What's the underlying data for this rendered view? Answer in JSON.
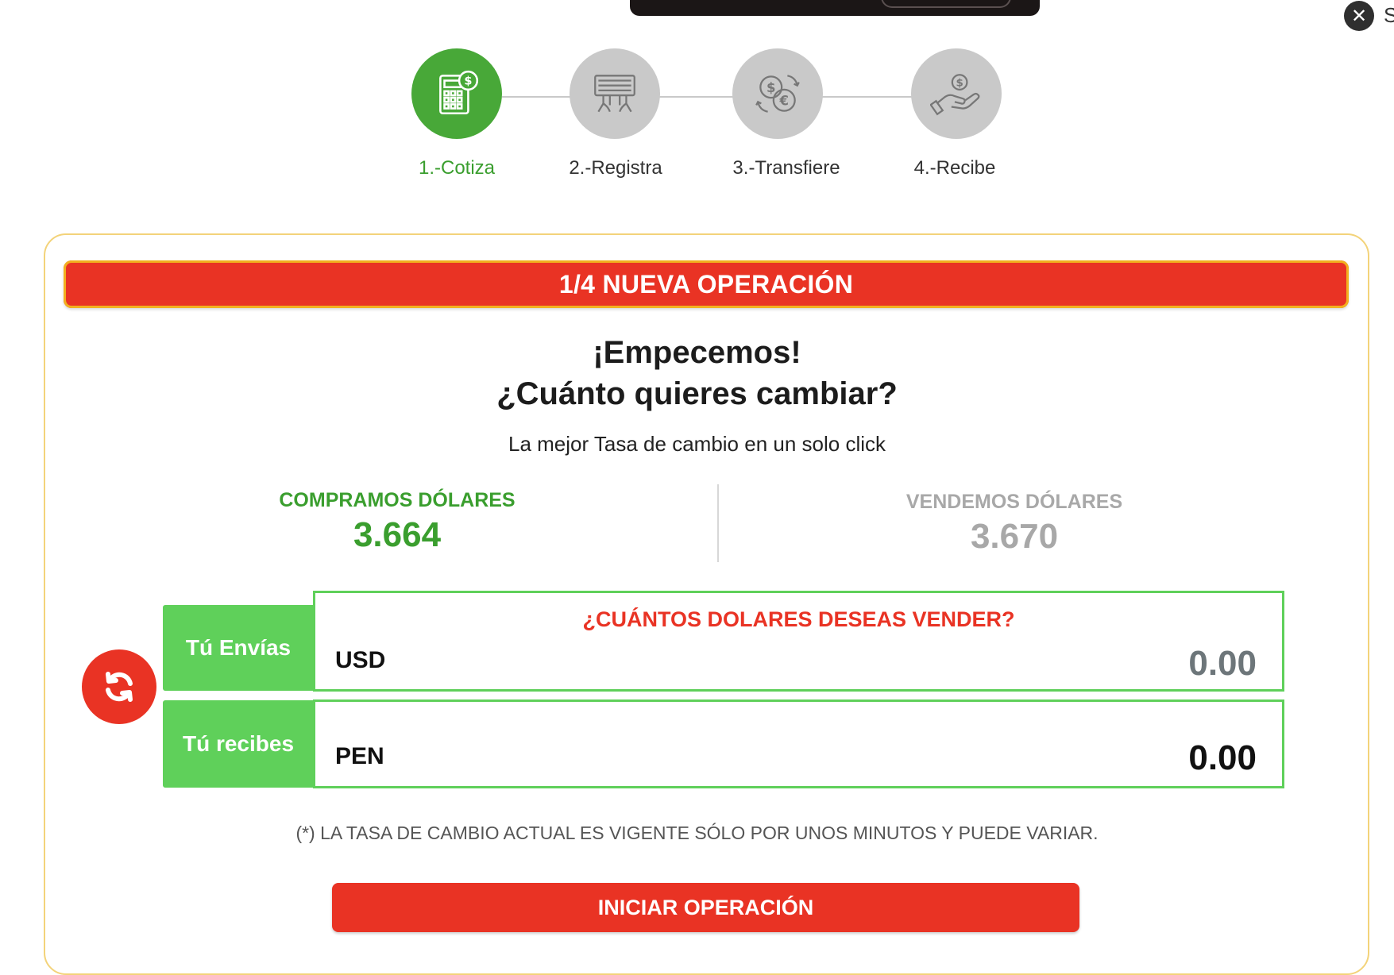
{
  "topbar": {
    "close_side_text": "S"
  },
  "steps": [
    {
      "label": "1.-Cotiza",
      "icon": "calculator-icon",
      "active": true
    },
    {
      "label": "2.-Registra",
      "icon": "keyboard-typing-icon",
      "active": false
    },
    {
      "label": "3.-Transfiere",
      "icon": "currency-exchange-icon",
      "active": false
    },
    {
      "label": "4.-Recibe",
      "icon": "hand-money-icon",
      "active": false
    }
  ],
  "banner": {
    "title": "1/4 NUEVA OPERACIÓN"
  },
  "heading": {
    "line1": "¡Empecemos!",
    "line2": "¿Cuánto quieres cambiar?",
    "subtitle": "La mejor Tasa de cambio en un solo click"
  },
  "rates": {
    "buy_label": "COMPRAMOS DÓLARES",
    "buy_value": "3.664",
    "sell_label": "VENDEMOS DÓLARES",
    "sell_value": "3.670"
  },
  "form": {
    "send_label": "Tú Envías",
    "receive_label": "Tú recibes",
    "question": "¿CUÁNTOS DOLARES DESEAS VENDER?",
    "send_currency": "USD",
    "send_amount": "0.00",
    "receive_currency": "PEN",
    "receive_amount": "0.00"
  },
  "disclaimer": "(*) LA TASA DE CAMBIO ACTUAL ES VIGENTE SÓLO POR UNOS MINUTOS Y PUEDE VARIAR.",
  "cta": {
    "label": "INICIAR OPERACIÓN"
  },
  "colors": {
    "accent_red": "#e93324",
    "active_green": "#48a838",
    "field_green": "#5fd05a",
    "inactive_gray": "#c9c9c9"
  }
}
